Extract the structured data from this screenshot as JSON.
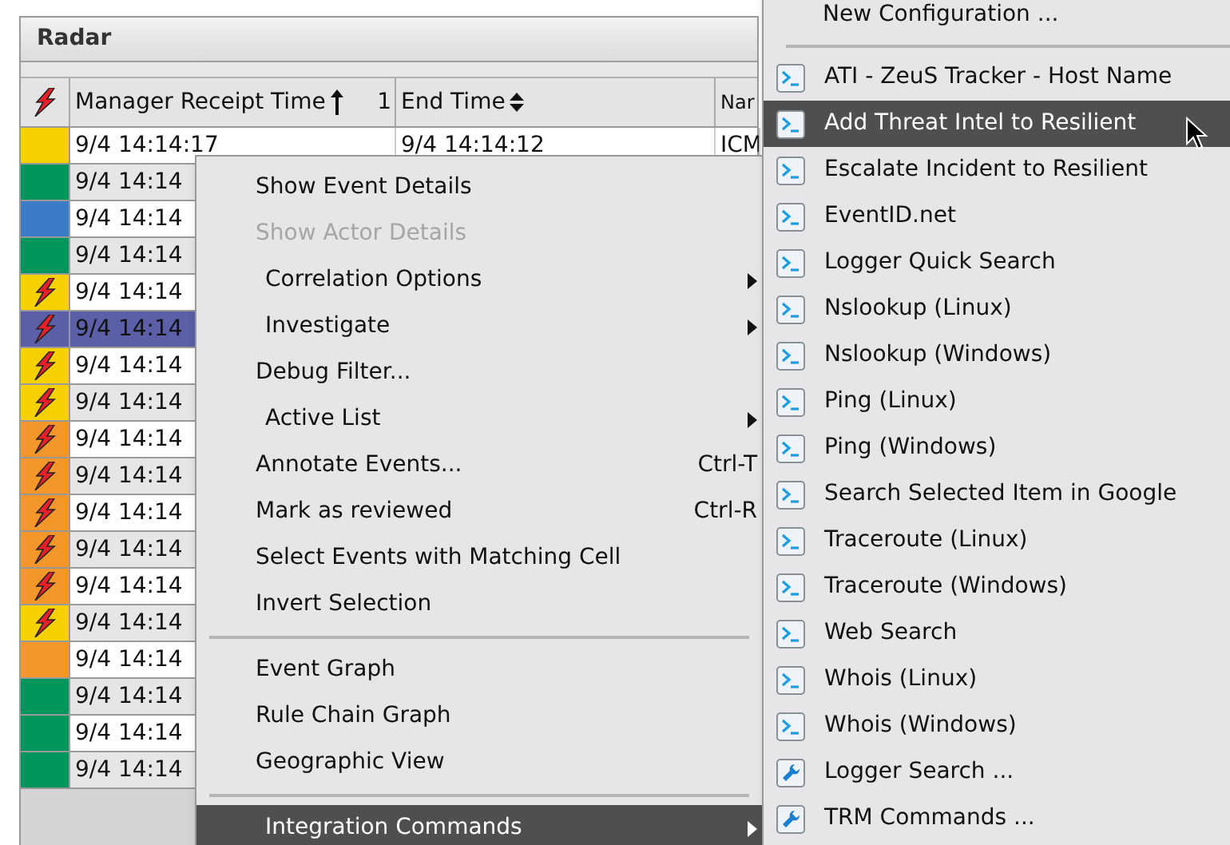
{
  "panel": {
    "title": "Radar"
  },
  "table": {
    "priority_header": {
      "kind": "bolt"
    },
    "columns": [
      {
        "label": "Manager Receipt Time",
        "sorted_ascending": true,
        "sort_rank": "1"
      },
      {
        "label": "End Time",
        "sorted_ascending": false
      },
      {
        "label": "Nar"
      }
    ],
    "rows": [
      {
        "color": "#f7d000",
        "bolt": false,
        "selected": false,
        "cells": [
          "9/4 14:14:17",
          "9/4 14:14:12",
          "ICM"
        ]
      },
      {
        "color": "#00955a",
        "bolt": false,
        "selected": false,
        "cells": [
          "9/4 14:14"
        ]
      },
      {
        "color": "#3a7cc6",
        "bolt": false,
        "selected": false,
        "cells": [
          "9/4 14:14"
        ]
      },
      {
        "color": "#00955a",
        "bolt": false,
        "selected": false,
        "cells": [
          "9/4 14:14"
        ]
      },
      {
        "color": "#f7d000",
        "bolt": true,
        "selected": false,
        "cells": [
          "9/4 14:14"
        ]
      },
      {
        "color": "#5a5fa8",
        "bolt": true,
        "selected": true,
        "cells": [
          "9/4 14:14"
        ]
      },
      {
        "color": "#f7d000",
        "bolt": true,
        "selected": false,
        "cells": [
          "9/4 14:14"
        ]
      },
      {
        "color": "#f7d000",
        "bolt": true,
        "selected": false,
        "cells": [
          "9/4 14:14"
        ]
      },
      {
        "color": "#f5962a",
        "bolt": true,
        "selected": false,
        "cells": [
          "9/4 14:14"
        ]
      },
      {
        "color": "#f5962a",
        "bolt": true,
        "selected": false,
        "cells": [
          "9/4 14:14"
        ]
      },
      {
        "color": "#f5962a",
        "bolt": true,
        "selected": false,
        "cells": [
          "9/4 14:14"
        ]
      },
      {
        "color": "#f5962a",
        "bolt": true,
        "selected": false,
        "cells": [
          "9/4 14:14"
        ]
      },
      {
        "color": "#f5962a",
        "bolt": true,
        "selected": false,
        "cells": [
          "9/4 14:14"
        ]
      },
      {
        "color": "#f7d000",
        "bolt": true,
        "selected": false,
        "cells": [
          "9/4 14:14"
        ]
      },
      {
        "color": "#f5962a",
        "bolt": false,
        "selected": false,
        "cells": [
          "9/4 14:14"
        ]
      },
      {
        "color": "#00955a",
        "bolt": false,
        "selected": false,
        "cells": [
          "9/4 14:14"
        ]
      },
      {
        "color": "#00955a",
        "bolt": false,
        "selected": false,
        "cells": [
          "9/4 14:14"
        ]
      },
      {
        "color": "#00955a",
        "bolt": false,
        "selected": false,
        "cells": [
          "9/4 14:14"
        ]
      }
    ]
  },
  "context_menu": {
    "items": [
      {
        "kind": "item",
        "label": "Show Event Details",
        "disabled": false,
        "submenu": false,
        "selected": false
      },
      {
        "kind": "item",
        "label": "Show Actor Details",
        "disabled": true,
        "submenu": false,
        "selected": false
      },
      {
        "kind": "item",
        "label": "Correlation Options",
        "disabled": false,
        "submenu": true,
        "selected": false
      },
      {
        "kind": "item",
        "label": "Investigate",
        "disabled": false,
        "submenu": true,
        "selected": false
      },
      {
        "kind": "item",
        "label": "Debug Filter...",
        "disabled": false,
        "submenu": false,
        "selected": false
      },
      {
        "kind": "item",
        "label": "Active List",
        "disabled": false,
        "submenu": true,
        "selected": false
      },
      {
        "kind": "item",
        "label": "Annotate Events...",
        "shortcut": "Ctrl-T",
        "disabled": false,
        "submenu": false,
        "selected": false
      },
      {
        "kind": "item",
        "label": "Mark as reviewed",
        "shortcut": "Ctrl-R",
        "disabled": false,
        "submenu": false,
        "selected": false
      },
      {
        "kind": "item",
        "label": "Select Events with Matching Cell",
        "disabled": false,
        "submenu": false,
        "selected": false
      },
      {
        "kind": "item",
        "label": "Invert Selection",
        "disabled": false,
        "submenu": false,
        "selected": false
      },
      {
        "kind": "separator"
      },
      {
        "kind": "item",
        "label": "Event Graph",
        "disabled": false,
        "submenu": false,
        "selected": false
      },
      {
        "kind": "item",
        "label": "Rule Chain Graph",
        "disabled": false,
        "submenu": false,
        "selected": false
      },
      {
        "kind": "item",
        "label": "Geographic View",
        "disabled": false,
        "submenu": false,
        "selected": false
      },
      {
        "kind": "separator"
      },
      {
        "kind": "item",
        "label": "Integration Commands",
        "disabled": false,
        "submenu": true,
        "selected": true
      }
    ]
  },
  "submenu": {
    "items": [
      {
        "kind": "plain",
        "label": "New Configuration ...",
        "selected": false
      },
      {
        "kind": "separator"
      },
      {
        "kind": "terminal",
        "label": "ATI - ZeuS Tracker - Host Name",
        "selected": false
      },
      {
        "kind": "terminal",
        "label": "Add Threat Intel to Resilient",
        "selected": true
      },
      {
        "kind": "terminal",
        "label": "Escalate Incident to Resilient",
        "selected": false
      },
      {
        "kind": "terminal",
        "label": "EventID.net",
        "selected": false
      },
      {
        "kind": "terminal",
        "label": "Logger Quick Search",
        "selected": false
      },
      {
        "kind": "terminal",
        "label": "Nslookup (Linux)",
        "selected": false
      },
      {
        "kind": "terminal",
        "label": "Nslookup (Windows)",
        "selected": false
      },
      {
        "kind": "terminal",
        "label": "Ping (Linux)",
        "selected": false
      },
      {
        "kind": "terminal",
        "label": "Ping (Windows)",
        "selected": false
      },
      {
        "kind": "terminal",
        "label": "Search Selected Item in Google",
        "selected": false
      },
      {
        "kind": "terminal",
        "label": "Traceroute (Linux)",
        "selected": false
      },
      {
        "kind": "terminal",
        "label": "Traceroute (Windows)",
        "selected": false
      },
      {
        "kind": "terminal",
        "label": "Web Search",
        "selected": false
      },
      {
        "kind": "terminal",
        "label": "Whois (Linux)",
        "selected": false
      },
      {
        "kind": "terminal",
        "label": "Whois (Windows)",
        "selected": false
      },
      {
        "kind": "wrench",
        "label": "Logger Search ...",
        "selected": false
      },
      {
        "kind": "wrench",
        "label": "TRM Commands ...",
        "selected": false
      }
    ]
  }
}
